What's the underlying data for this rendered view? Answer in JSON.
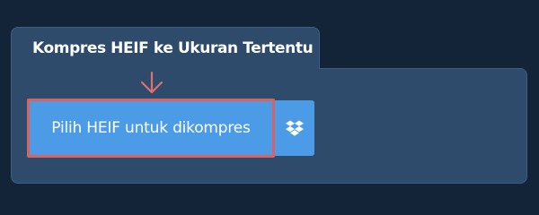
{
  "converter": {
    "title": "Kompres HEIF ke Ukuran Tertentu",
    "upload_button_label": "Pilih HEIF untuk dikompres",
    "dropbox_icon": "dropbox-icon",
    "arrow_icon": "arrow-down-icon"
  },
  "colors": {
    "background": "#132338",
    "panel": "#2e4b6c",
    "button": "#4b9be6",
    "highlight": "#d96262"
  }
}
